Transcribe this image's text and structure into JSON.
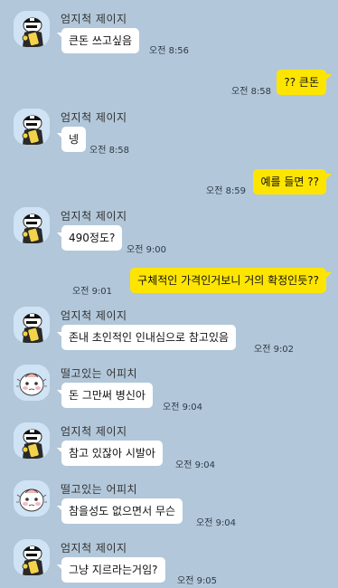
{
  "colors": {
    "background": "#b2c7d9",
    "incoming_bubble": "#ffffff",
    "outgoing_bubble": "#fee500"
  },
  "messages": [
    {
      "sender": "엄지척 제이지",
      "avatar": "jay-g-avatar-icon",
      "text": "큰돈 쓰고싶음",
      "time": "오전 8:56"
    },
    {
      "sender": "me",
      "text": "?? 큰돈",
      "time": "오전 8:58"
    },
    {
      "sender": "엄지척 제이지",
      "avatar": "jay-g-avatar-icon",
      "text": "넹",
      "time": "오전 8:58"
    },
    {
      "sender": "me",
      "text": "예를 들면 ??",
      "time": "오전 8:59"
    },
    {
      "sender": "엄지척 제이지",
      "avatar": "jay-g-avatar-icon",
      "text": "490정도?",
      "time": "오전 9:00"
    },
    {
      "sender": "me",
      "text": "구체적인 가격인거보니 거의 확정인듯??",
      "time": "오전 9:01"
    },
    {
      "sender": "엄지척 제이지",
      "avatar": "jay-g-avatar-icon",
      "text": "존내 초인적인 인내심으로 참고있음",
      "time": "오전 9:02"
    },
    {
      "sender": "떨고있는 어피치",
      "avatar": "apeach-avatar-icon",
      "text": "돈 그만써 병신아",
      "time": "오전 9:04"
    },
    {
      "sender": "엄지척 제이지",
      "avatar": "jay-g-avatar-icon",
      "text": "참고 있잖아 시발아",
      "time": "오전 9:04"
    },
    {
      "sender": "떨고있는 어피치",
      "avatar": "apeach-avatar-icon",
      "text": "참을성도 없으면서 무슨",
      "time": "오전 9:04"
    },
    {
      "sender": "엄지척 제이지",
      "avatar": "jay-g-avatar-icon",
      "text": "그냥 지르라는거임?",
      "time": "오전 9:05"
    }
  ]
}
